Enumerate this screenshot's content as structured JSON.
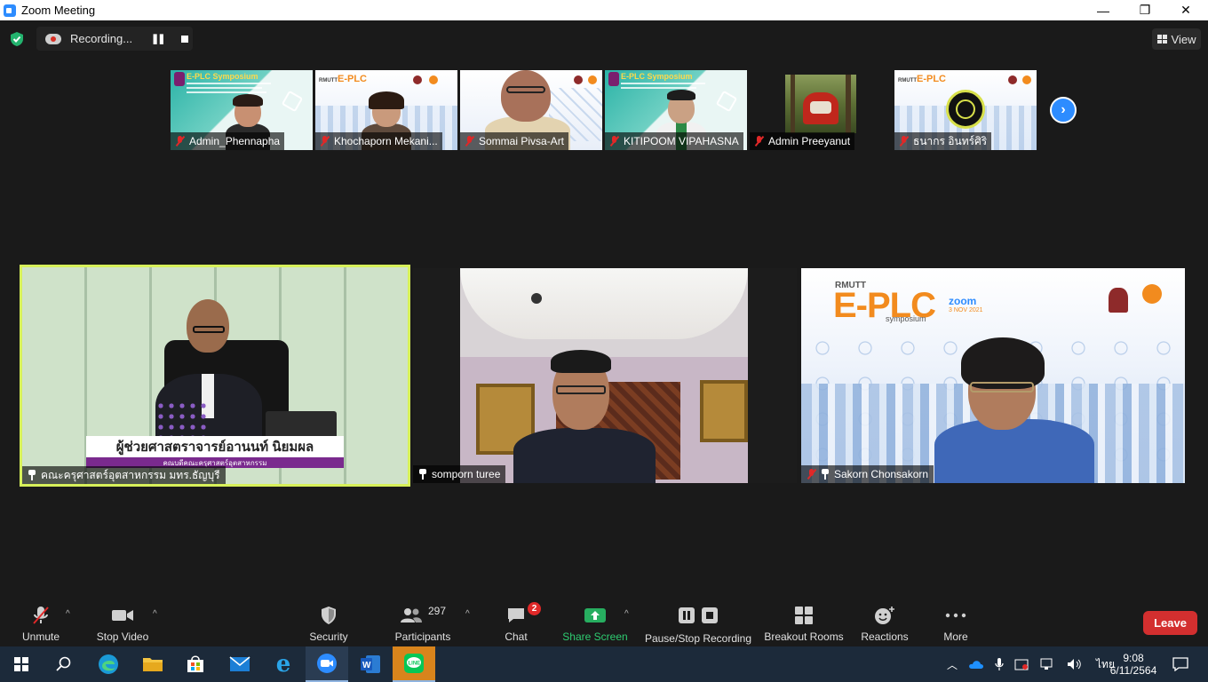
{
  "window": {
    "title": "Zoom Meeting",
    "minimize": "—",
    "maximize": "❐",
    "close": "✕"
  },
  "recording": {
    "label": "Recording...",
    "pause": "❚❚"
  },
  "view": {
    "label": "View"
  },
  "thumbnails": [
    {
      "name": "Admin_Phennapha",
      "muted": true
    },
    {
      "name": "Khochaporn Mekani...",
      "muted": true
    },
    {
      "name": "Sommai Pivsa-Art",
      "muted": true
    },
    {
      "name": "KITIPOOM VIPAHASNA",
      "muted": true
    },
    {
      "name": "Admin Preeyanut",
      "muted": true
    },
    {
      "name": "ธนากร อินทร์ศิริ",
      "muted": true
    }
  ],
  "slide": {
    "brand": "E-PLC",
    "prefix": "RMUTT",
    "sub": "symposium",
    "zoom": "zoom",
    "date": "3 NOV 2021",
    "small_title": "E-PLC Symposium"
  },
  "main_videos": [
    {
      "name": "คณะครุศาสตร์อุตสาหกรรม มทร.ธัญบุรี",
      "caption": "ผู้ช่วยศาสตราจารย์อานนท์ นิยมผล",
      "subcaption": "คณบดีคณะครุศาสตร์อุตสาหกรรม"
    },
    {
      "name": "somporn turee"
    },
    {
      "name": "Sakorn  Chonsakorn"
    }
  ],
  "toolbar": {
    "unmute": "Unmute",
    "stop_video": "Stop Video",
    "security": "Security",
    "participants": "Participants",
    "participants_count": "297",
    "chat": "Chat",
    "chat_badge": "2",
    "share_screen": "Share Screen",
    "pause_stop_recording": "Pause/Stop Recording",
    "breakout_rooms": "Breakout Rooms",
    "reactions": "Reactions",
    "more": "More",
    "leave": "Leave",
    "caret": "^"
  },
  "taskbar": {
    "time": "9:08",
    "date": "6/11/2564",
    "language": "ไทย"
  },
  "colors": {
    "accent": "#2d8cff",
    "active_speaker_border": "#d7f05a",
    "leave": "#d32f2f",
    "share_green": "#27ae60"
  }
}
